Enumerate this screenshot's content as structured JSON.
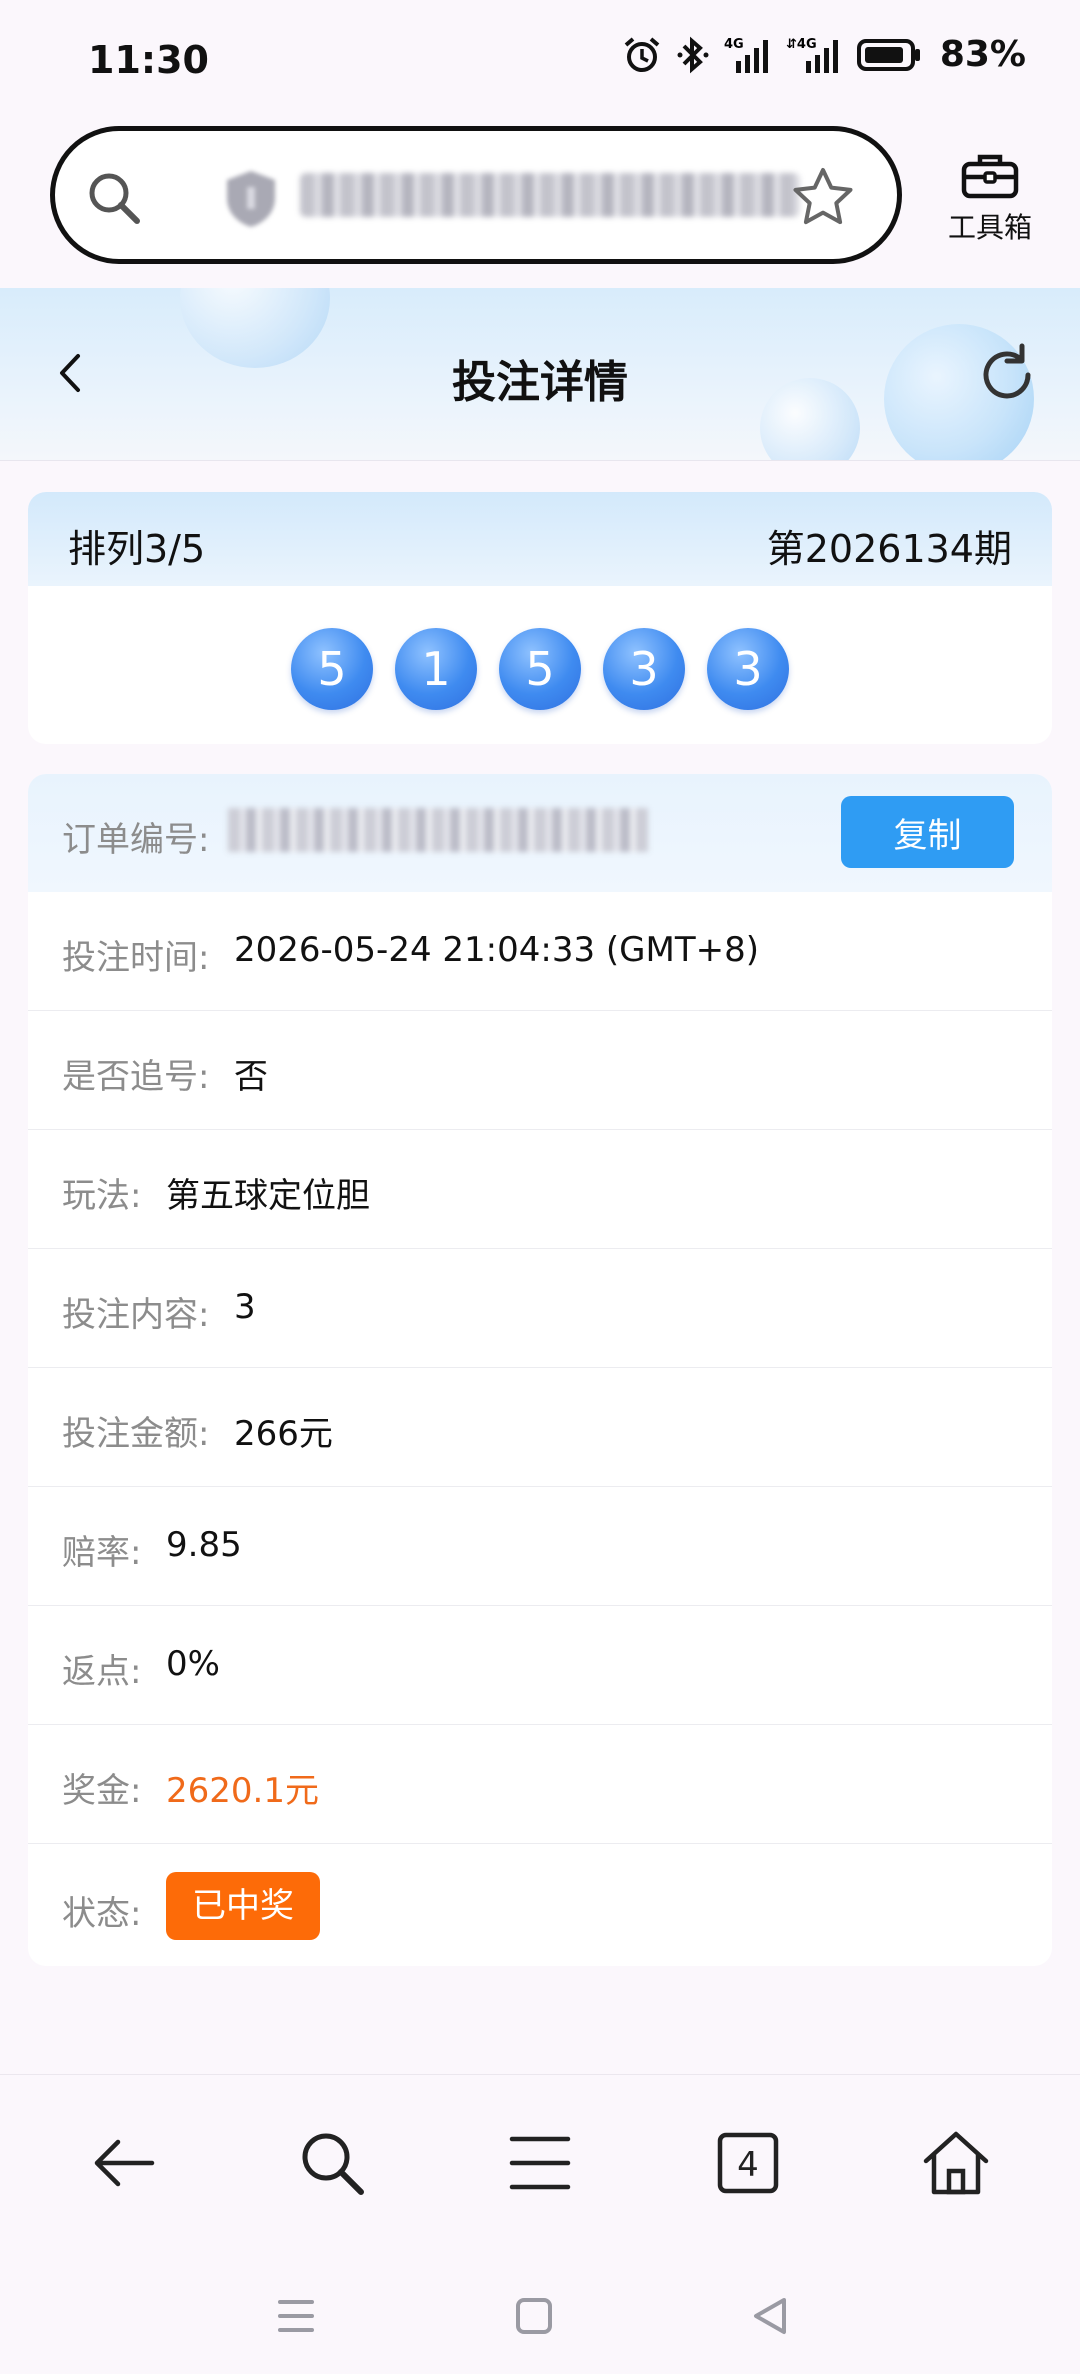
{
  "status_bar": {
    "time": "11:30",
    "battery": "83%",
    "icons": [
      "alarm-icon",
      "bluetooth-icon",
      "signal-4g-icon",
      "signal-4g-icon",
      "battery-icon"
    ]
  },
  "browser": {
    "toolbox_label": "工具箱"
  },
  "header": {
    "title": "投注详情"
  },
  "draw": {
    "lottery": "排列3/5",
    "issue": "第2026134期",
    "balls": [
      "5",
      "1",
      "5",
      "3",
      "3"
    ]
  },
  "order": {
    "label": "订单编号:",
    "copy_label": "复制"
  },
  "details": [
    {
      "label": "投注时间:",
      "value": "2026-05-24 21:04:33 (GMT+8)"
    },
    {
      "label": "是否追号:",
      "value": "否"
    },
    {
      "label": "玩法:",
      "value": "第五球定位胆"
    },
    {
      "label": "投注内容:",
      "value": "3"
    },
    {
      "label": "投注金额:",
      "value": "266元"
    },
    {
      "label": "赔率:",
      "value": "9.85"
    },
    {
      "label": "返点:",
      "value": "0%"
    },
    {
      "label": "奖金:",
      "value": "2620.1元"
    },
    {
      "label": "状态:",
      "value": "已中奖"
    }
  ],
  "bottom_nav": {
    "tab_count": "4"
  },
  "colors": {
    "accent_blue": "#2f9cf3",
    "ball_blue": "#3f8bf0",
    "prize_orange": "#f06a1a",
    "status_orange": "#fd6b08"
  }
}
